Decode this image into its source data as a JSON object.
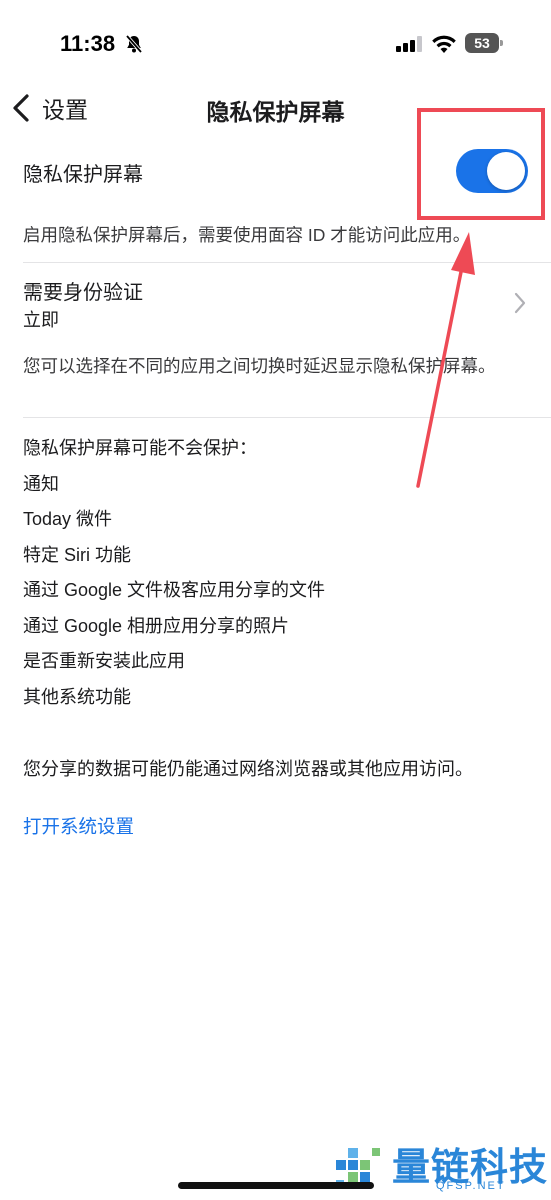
{
  "status_bar": {
    "time": "11:38",
    "battery": "53",
    "icons": [
      "bell-slash-icon",
      "signal-icon",
      "wifi-icon",
      "battery-icon"
    ]
  },
  "nav": {
    "back_label": "设置",
    "title": "隐私保护屏幕"
  },
  "privacy_screen": {
    "label": "隐私保护屏幕",
    "enabled": true,
    "description": "启用隐私保护屏幕后，需要使用面容 ID 才能访问此应用。"
  },
  "auth": {
    "label": "需要身份验证",
    "value": "立即",
    "description": "您可以选择在不同的应用之间切换时延迟显示隐私保护屏幕。"
  },
  "not_protected": {
    "heading": "隐私保护屏幕可能不会保护：",
    "items": [
      "通知",
      "Today 微件",
      "特定 Siri 功能",
      "通过 Google 文件极客应用分享的文件",
      "通过 Google 相册应用分享的照片",
      "是否重新安装此应用",
      "其他系统功能"
    ],
    "footer": "您分享的数据可能仍能通过网络浏览器或其他应用访问。"
  },
  "link": {
    "label": "打开系统设置"
  },
  "watermark": {
    "text": "量链科技",
    "sub": "QFSP.NET"
  },
  "colors": {
    "accent": "#1a73e8",
    "annotation": "#ee4a55",
    "watermark": "#2a86d8"
  }
}
